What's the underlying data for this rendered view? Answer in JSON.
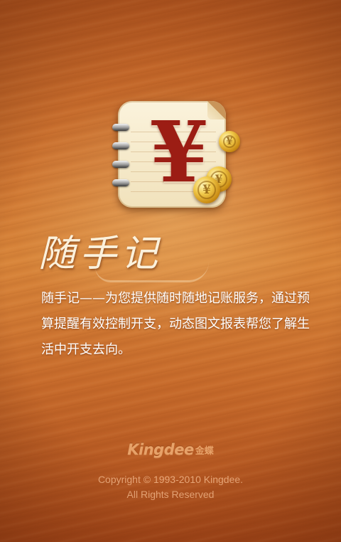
{
  "splash": {
    "app_title": "随手记",
    "description": "随手记——为您提供随时随地记账服务，通过预算提醒有效控制开支，动态图文报表帮您了解生活中开支去向。",
    "icon": {
      "name": "notebook-yen-icon",
      "symbol": "¥",
      "coin_glyph": "¥"
    },
    "brand": {
      "name": "Kingdee",
      "name_cn": "金蝶"
    },
    "copyright_line1": "Copyright © 1993-2010 Kingdee.",
    "copyright_line2": "All Rights Reserved"
  },
  "colors": {
    "wood_mid": "#cd7431",
    "wood_dark": "#a7491a",
    "yen_red": "#9c1d14",
    "brand_orange": "#e7a269",
    "text_white": "#ffffff"
  }
}
